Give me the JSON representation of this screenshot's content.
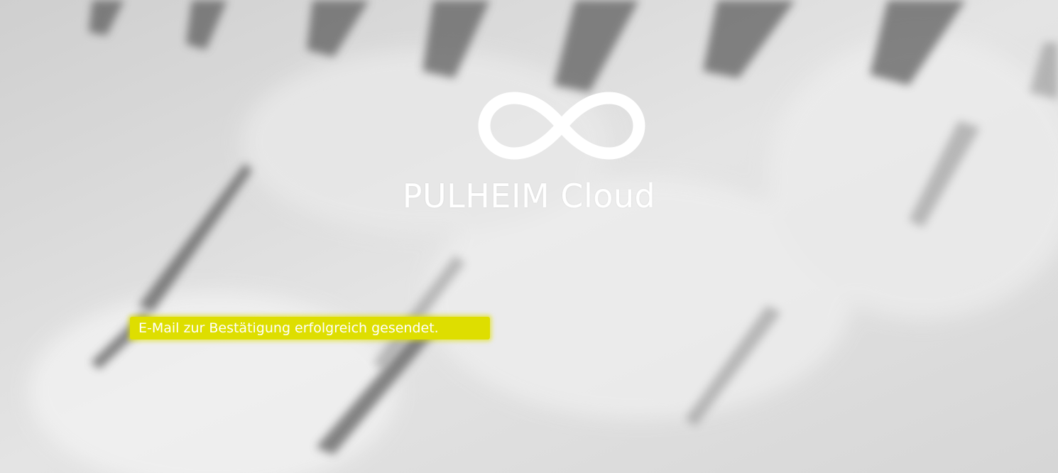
{
  "brand": {
    "logo_icon": "infinity-icon",
    "title": "PULHEIM Cloud"
  },
  "notification": {
    "message": "E-Mail zur Bestätigung erfolgreich gesendet.",
    "highlight_color": "#dede00",
    "text_color": "#ffffff"
  },
  "background": {
    "description_icon": "waterfall-background",
    "base_color": "#d9d9d9"
  }
}
